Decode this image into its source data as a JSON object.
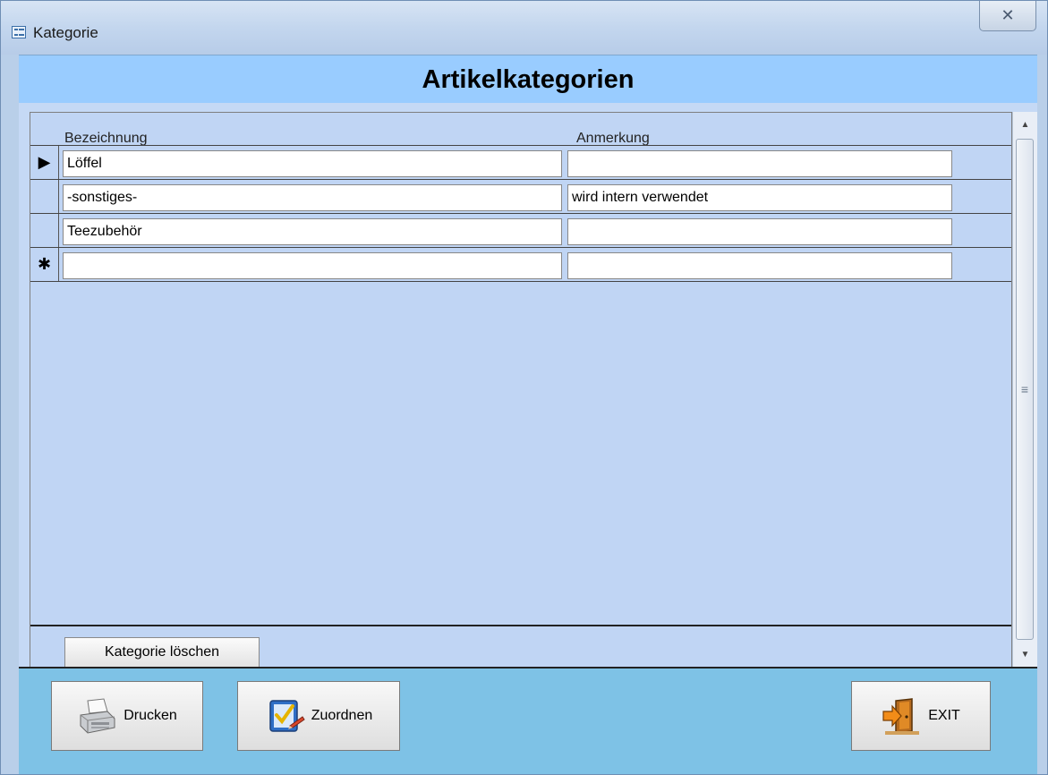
{
  "window": {
    "title": "Kategorie",
    "close_symbol": "✕"
  },
  "form": {
    "heading": "Artikelkategorien"
  },
  "grid": {
    "columns": [
      "Bezeichnung",
      "Anmerkung"
    ],
    "rows": [
      {
        "selector": "current",
        "bezeichnung": "Löffel",
        "anmerkung": ""
      },
      {
        "selector": "",
        "bezeichnung": "-sonstiges-",
        "anmerkung": "wird intern verwendet"
      },
      {
        "selector": "",
        "bezeichnung": "Teezubehör",
        "anmerkung": ""
      },
      {
        "selector": "new",
        "bezeichnung": "",
        "anmerkung": ""
      }
    ],
    "selector_symbols": {
      "current": "▶",
      "new": "✱"
    },
    "delete_button": "Kategorie löschen"
  },
  "footer": {
    "print_button": {
      "label": "Drucken",
      "icon": "printer-icon"
    },
    "assign_button": {
      "label": "Zuordnen",
      "icon": "checklist-icon"
    },
    "exit_button": {
      "label": "EXIT",
      "icon": "exit-door-icon"
    }
  },
  "colors": {
    "header_band": "#99ccff",
    "grid_background": "#c0d5f4",
    "footer_background": "#7ec2e6"
  }
}
